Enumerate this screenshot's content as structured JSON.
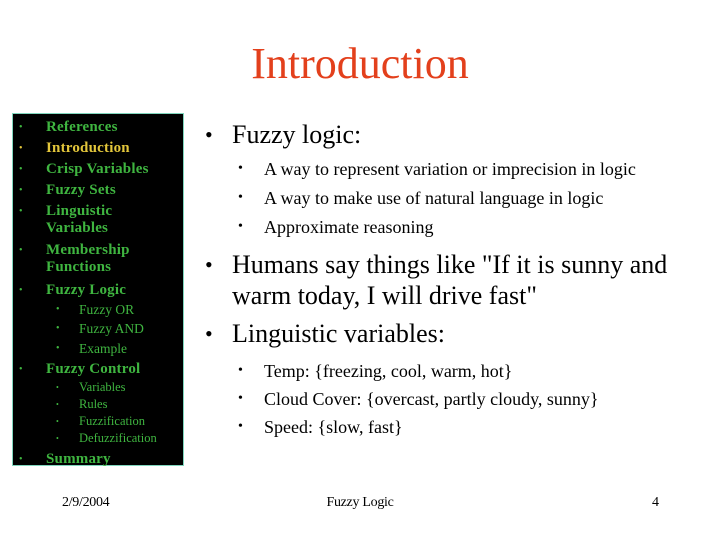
{
  "slide": {
    "title": "Introduction",
    "colors": {
      "title": "#e3401c",
      "sidebar_background": "#000000",
      "sidebar_border": "#7fd6bd",
      "sidebar_text": "#3fb540",
      "sidebar_active": "#e3c63b"
    }
  },
  "sidebar": {
    "bullet": "•",
    "items": [
      {
        "label": "References",
        "active": false
      },
      {
        "label": "Introduction",
        "active": true
      },
      {
        "label": "Crisp Variables",
        "active": false
      },
      {
        "label": "Fuzzy Sets",
        "active": false
      },
      {
        "label": "Linguistic Variables",
        "active": false
      },
      {
        "label": "Membership Functions",
        "active": false
      },
      {
        "label": "Fuzzy Logic",
        "active": false,
        "children": [
          "Fuzzy OR",
          "Fuzzy AND",
          "Example"
        ]
      },
      {
        "label": "Fuzzy Control",
        "active": false,
        "children": [
          "Variables",
          "Rules",
          "Fuzzification",
          "Defuzzification"
        ]
      },
      {
        "label": "Summary",
        "active": false
      }
    ]
  },
  "content": {
    "bullet": "•",
    "blocks": [
      {
        "text": "Fuzzy logic:",
        "sub": [
          "A way to represent variation or imprecision in logic",
          "A way to make use of natural language in logic",
          "Approximate reasoning"
        ]
      },
      {
        "text": "Humans say things like \"If it is sunny and warm today, I will drive fast\"",
        "sub": []
      },
      {
        "text": "Linguistic variables:",
        "sub": [
          "Temp: {freezing, cool, warm, hot}",
          "Cloud Cover: {overcast, partly cloudy, sunny}",
          "Speed: {slow, fast}"
        ]
      }
    ]
  },
  "footer": {
    "date": "2/9/2004",
    "title": "Fuzzy Logic",
    "page": "4"
  }
}
